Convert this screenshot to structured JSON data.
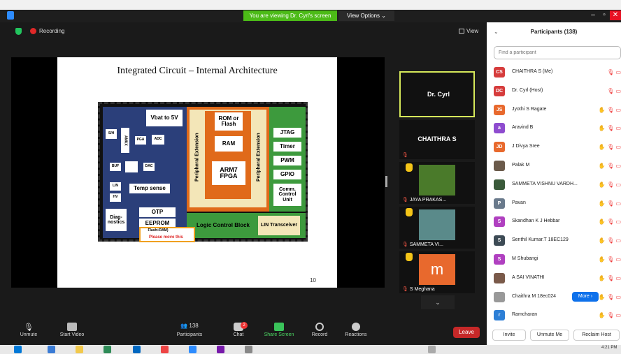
{
  "window": {
    "viewing_banner": "You are viewing Dr. Cyrl's screen",
    "view_options": "View Options ⌄"
  },
  "meeting": {
    "recording_label": "Recording",
    "view_label": "View"
  },
  "slide": {
    "title": "Integrated Circuit – Internal Architecture",
    "page_number": "10",
    "blocks": {
      "vbat": "Vbat to 5V",
      "sh": "S/H",
      "amux": "AMUX",
      "pga": "PGA",
      "adc": "ADC",
      "buf": "BUF",
      "dac": "DAC",
      "lin": "LIN",
      "hv": "HV",
      "temp": "Temp sense",
      "diag": "Diag-nostics",
      "otp": "OTP",
      "eeprom": "EEPROM",
      "flash_ram": "Flash+RAM)",
      "periph_left": "Peripheral Extension",
      "periph_right": "Peripheral Extension",
      "rom": "ROM or Flash",
      "ram": "RAM",
      "arm": "ARM7 FPGA",
      "jtag": "JTAG",
      "timer": "Timer",
      "pwm": "PWM",
      "gpio": "GPIO",
      "comm": "Comm. Control Unit",
      "logic": "Logic Control Block",
      "lin_tx": "LIN Transceiver"
    },
    "annotation": "Please move this"
  },
  "tiles": [
    {
      "name": "Dr. Cyrl"
    },
    {
      "name": "CHAITHRA S"
    },
    {
      "label": "JAYA PRAKAS..."
    },
    {
      "label": "SAMMETA VI..."
    },
    {
      "label": "S Meghana",
      "initial": "m"
    }
  ],
  "toolbar": {
    "unmute": "Unmute",
    "start_video": "Start Video",
    "participants": "Participants",
    "participants_count": "138",
    "chat": "Chat",
    "chat_badge": "2",
    "share_screen": "Share Screen",
    "record": "Record",
    "reactions": "Reactions",
    "leave": "Leave"
  },
  "panel": {
    "title": "Participants (138)",
    "search_placeholder": "Find a participant",
    "participants": [
      {
        "initials": "CS",
        "color": "#d63c3c",
        "name": "CHAITHRA S (Me)",
        "hand": false
      },
      {
        "initials": "DC",
        "color": "#d63c3c",
        "name": "Dr. Cyrl (Host)",
        "hand": false
      },
      {
        "initials": "JS",
        "color": "#e8692d",
        "name": "Jyothi S Ragate",
        "hand": true
      },
      {
        "initials": "a",
        "color": "#8e4ccf",
        "name": "Aravind B",
        "hand": true
      },
      {
        "initials": "JD",
        "color": "#e8692d",
        "name": "J Divya Sree",
        "hand": true
      },
      {
        "initials": "",
        "color": "#6b5b4b",
        "name": "Palak M",
        "hand": true
      },
      {
        "initials": "",
        "color": "#3a5a3a",
        "name": "SAMMETA VISHNU VARDH...",
        "hand": true
      },
      {
        "initials": "P",
        "color": "#6a7a8c",
        "name": "Pavan",
        "hand": true
      },
      {
        "initials": "S",
        "color": "#b040c0",
        "name": "Skandhan K J Hebbar",
        "hand": true
      },
      {
        "initials": "S",
        "color": "#3d4b55",
        "name": "Senthil Kumar.T 18EC129",
        "hand": true
      },
      {
        "initials": "S",
        "color": "#b040c0",
        "name": "M Shubangi",
        "hand": true
      },
      {
        "initials": "",
        "color": "#7a5a4a",
        "name": "A SAI VINATHI",
        "hand": true
      },
      {
        "initials": "",
        "color": "#999999",
        "name": "Chaithra M 18ec024",
        "hand": true
      },
      {
        "initials": "r",
        "color": "#2d7fd6",
        "name": "Ramcharan",
        "hand": true
      }
    ],
    "more_label": "More ›",
    "invite": "Invite",
    "unmute_me": "Unmute Me",
    "reclaim_host": "Reclaim Host"
  },
  "taskbar": {
    "time": "4:21 PM"
  }
}
